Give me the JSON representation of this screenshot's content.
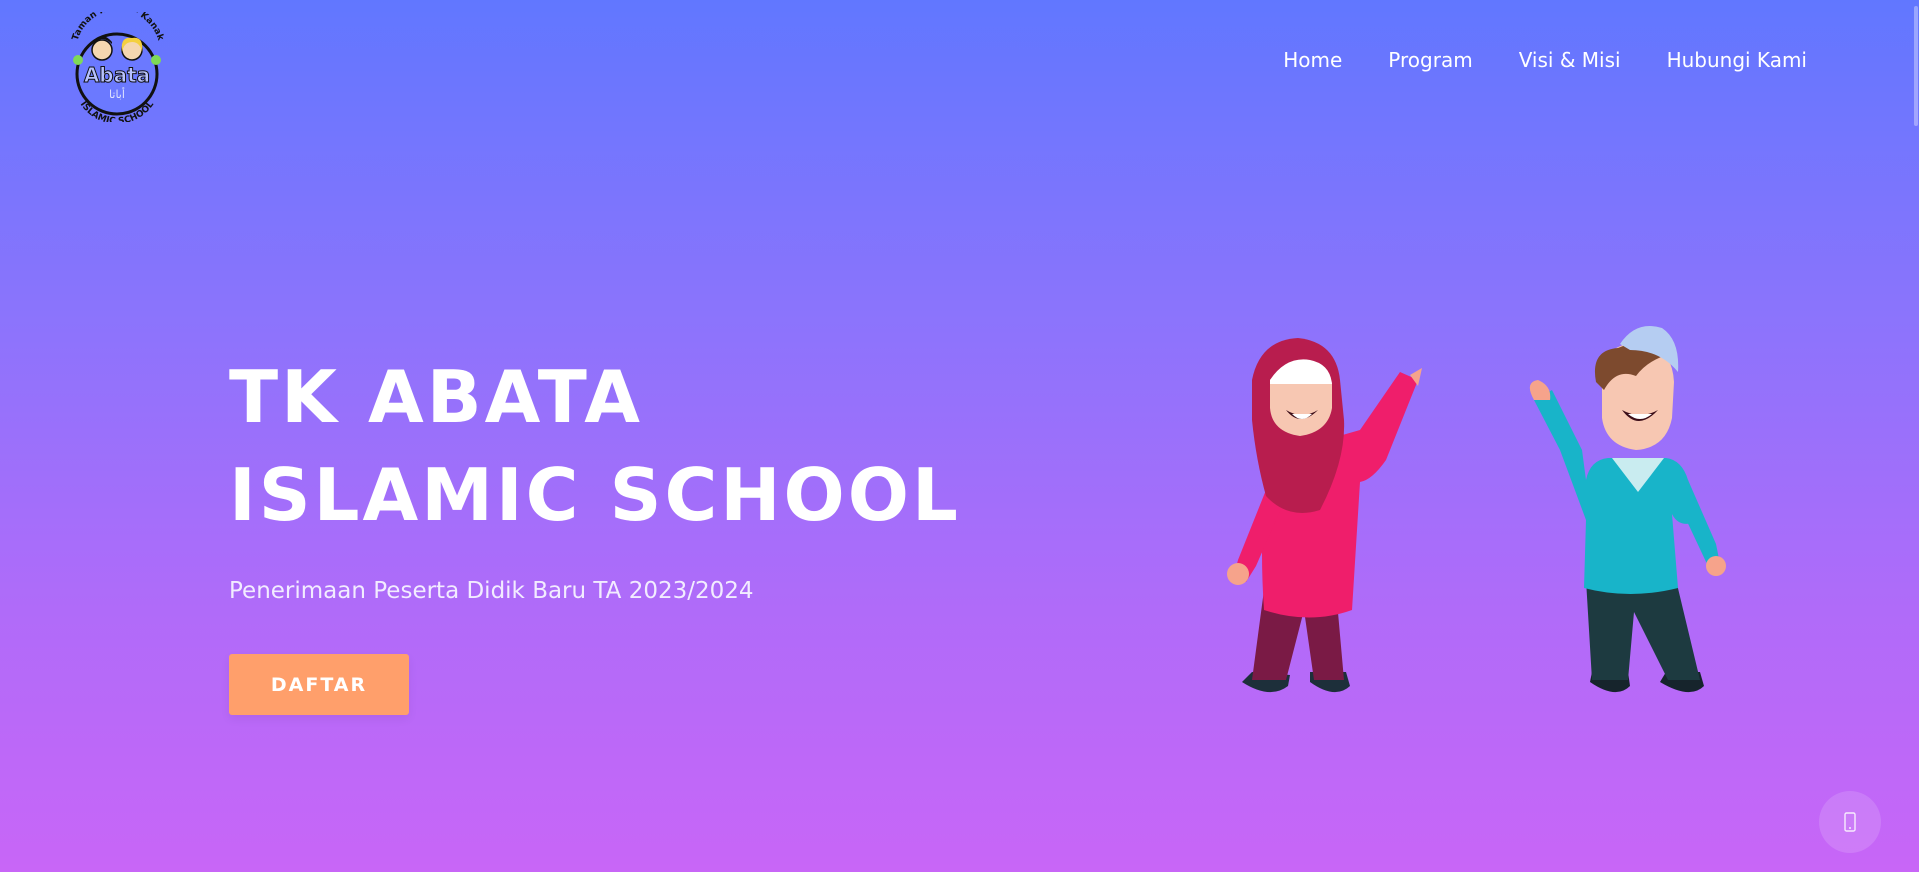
{
  "logo": {
    "top_text": "Taman Kanak - Kanak",
    "brand": "Abata",
    "arabic": "أباتا",
    "bottom_text": "ISLAMIC SCHOOL"
  },
  "nav": {
    "items": [
      {
        "label": "Home"
      },
      {
        "label": "Program"
      },
      {
        "label": "Visi & Misi"
      },
      {
        "label": "Hubungi Kami"
      }
    ]
  },
  "hero": {
    "title_line1": "TK ABATA",
    "title_line2": "ISLAMIC SCHOOL",
    "subtitle": "Penerimaan Peserta Didik Baru TA 2023/2024",
    "cta_label": "DAFTAR"
  },
  "floating_button": {
    "icon": "phone-icon"
  },
  "colors": {
    "gradient_top": "#6177ff",
    "gradient_bottom": "#c866f7",
    "cta": "#ff9f6b",
    "girl_dress": "#ef1e6b",
    "girl_hijab": "#b81d4e",
    "boy_shirt": "#18b4c9",
    "boy_cap": "#b5cdf2"
  }
}
